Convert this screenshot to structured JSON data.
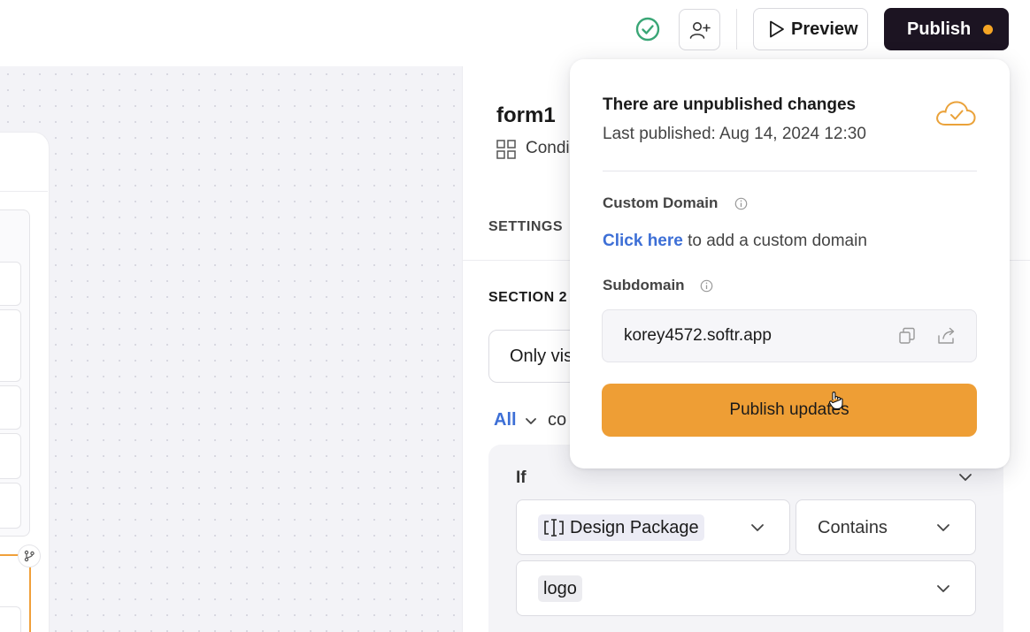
{
  "topbar": {
    "preview_label": "Preview",
    "publish_label": "Publish",
    "publish_dot_color": "#f5a524",
    "status_color": "#3aa676"
  },
  "panel": {
    "form_title": "form1",
    "condition_label": "Condi",
    "settings_tab": "SETTINGS",
    "section_label": "SECTION 2",
    "visibility_value": "Only vis",
    "match_mode": "All",
    "match_suffix": "co",
    "if_label": "If",
    "condition": {
      "field": "Design Package",
      "operator": "Contains",
      "value": "logo"
    }
  },
  "popover": {
    "title": "There are unpublished changes",
    "last_published": "Last published: Aug 14, 2024 12:30",
    "custom_domain_label": "Custom Domain",
    "custom_domain_link": "Click here",
    "custom_domain_rest": " to add a custom domain",
    "subdomain_label": "Subdomain",
    "subdomain_value": "korey4572.softr.app",
    "publish_updates_label": "Publish updates",
    "accent_color": "#ee9e35",
    "link_color": "#3d6fd6"
  }
}
